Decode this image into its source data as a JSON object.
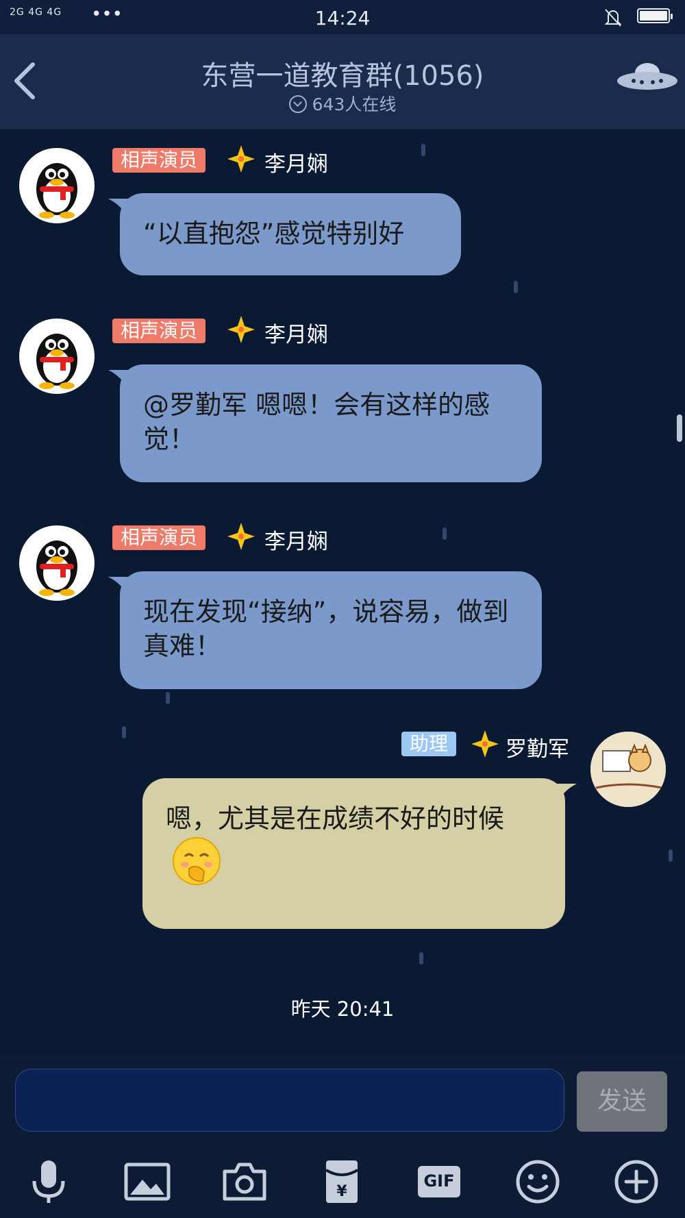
{
  "status_bar": {
    "signal": "2G 4G 4G",
    "dots": "•••",
    "time": "14:24"
  },
  "header": {
    "title": "东营一道教育群(1056)",
    "online": "643人在线"
  },
  "messages": [
    {
      "badge": "相声演员",
      "sender": "李月娴",
      "text": "“以直抱怨”感觉特别好"
    },
    {
      "badge": "相声演员",
      "sender": "李月娴",
      "text": "@罗勤军 嗯嗯！会有这样的感觉！"
    },
    {
      "badge": "相声演员",
      "sender": "李月娴",
      "text": "现在发现“接纳”，说容易，做到真难！"
    },
    {
      "badge": "助理",
      "sender": "罗勤军",
      "text": "嗯，尤其是在成绩不好的时候"
    }
  ],
  "timestamp": "昨天 20:41",
  "input": {
    "value": "",
    "send_label": "发送"
  },
  "toolbar": {
    "gif_label": "GIF",
    "icons": [
      "microphone-icon",
      "image-icon",
      "camera-icon",
      "red-packet-icon",
      "gif-icon",
      "emoji-icon",
      "plus-icon"
    ]
  },
  "colors": {
    "background": "#0b1a33",
    "header": "#1a2b4d",
    "bubble_incoming": "#7b9acb",
    "bubble_outgoing": "#d4cfa4",
    "badge_red": "#f07a6a",
    "badge_blue": "#9cc7f2"
  }
}
